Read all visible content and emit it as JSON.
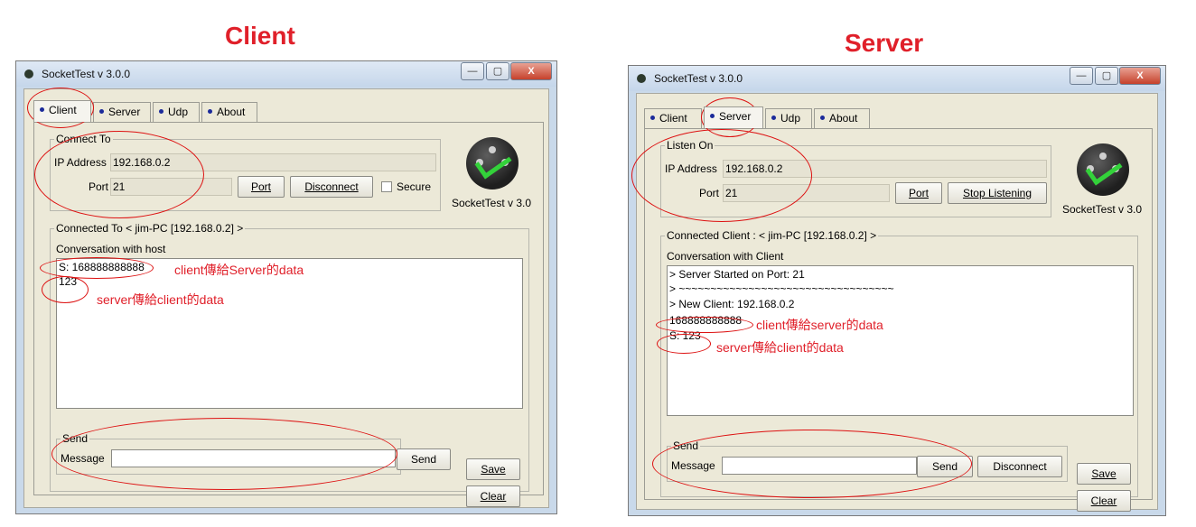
{
  "colors": {
    "annotation": "#e0202a",
    "accent_check": "#33d13a",
    "tab_dot": "#1b2a9a"
  },
  "client": {
    "heading": "Client",
    "window_title": "SocketTest v 3.0.0",
    "window_buttons": [
      "—",
      "▢",
      "X"
    ],
    "tabs": [
      "Client",
      "Server",
      "Udp",
      "About"
    ],
    "connect_group": "Connect To",
    "ip_label": "IP Address",
    "ip_value": "192.168.0.2",
    "port_label": "Port",
    "port_value": "21",
    "port_button": "Port",
    "disconnect_button": "Disconnect",
    "secure_label": "Secure",
    "logo_caption": "SocketTest v 3.0",
    "connected_group": "Connected To <  jim-PC [192.168.0.2]  >",
    "conversation_label": "Conversation with host",
    "conversation_lines": [
      "S: 168888888888",
      "123"
    ],
    "send_group": "Send",
    "message_label": "Message",
    "send_button": "Send",
    "save_button": "Save",
    "clear_button": "Clear",
    "annotations": [
      "client傳給Server的data",
      "server傳給client的data"
    ]
  },
  "server": {
    "heading": "Server",
    "window_title": "SocketTest v 3.0.0",
    "window_buttons": [
      "—",
      "▢",
      "X"
    ],
    "tabs": [
      "Client",
      "Server",
      "Udp",
      "About"
    ],
    "listen_group": "Listen On",
    "ip_label": "IP Address",
    "ip_value": "192.168.0.2",
    "port_label": "Port",
    "port_value": "21",
    "port_button": "Port",
    "stop_button": "Stop Listening",
    "logo_caption": "SocketTest v 3.0",
    "connected_group": "Connected Client : <  jim-PC [192.168.0.2]  >",
    "conversation_label": "Conversation with Client",
    "conversation_lines": [
      "> Server Started on Port: 21",
      "> ~~~~~~~~~~~~~~~~~~~~~~~~~~~~~~~~~~",
      "> New Client: 192.168.0.2",
      "168888888888",
      "S: 123"
    ],
    "send_group": "Send",
    "message_label": "Message",
    "send_button": "Send",
    "disconnect_button": "Disconnect",
    "save_button": "Save",
    "clear_button": "Clear",
    "annotations": [
      "client傳給server的data",
      "server傳給client的data"
    ]
  }
}
